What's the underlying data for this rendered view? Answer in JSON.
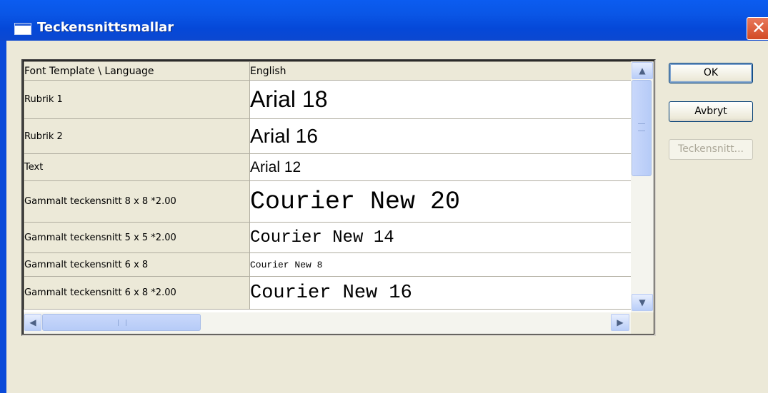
{
  "window": {
    "title": "Teckensnittsmallar",
    "close_glyph": "✕"
  },
  "grid": {
    "headers": [
      "Font Template \\ Language",
      "English"
    ],
    "rows": [
      {
        "template": "Rubrik 1",
        "font": "Arial 18"
      },
      {
        "template": "Rubrik 2",
        "font": "Arial 16"
      },
      {
        "template": "Text",
        "font": "Arial 12"
      },
      {
        "template": "Gammalt teckensnitt 8 x 8 *2.00",
        "font": "Courier New 20"
      },
      {
        "template": "Gammalt teckensnitt 5 x 5 *2.00",
        "font": "Courier New 14"
      },
      {
        "template": "Gammalt teckensnitt 6 x 8",
        "font": "Courier New 8"
      },
      {
        "template": "Gammalt teckensnitt 6 x 8 *2.00",
        "font": "Courier New 16"
      }
    ]
  },
  "scrollbar": {
    "up": "▲",
    "down": "▼",
    "left": "◀",
    "right": "▶"
  },
  "buttons": {
    "ok": "OK",
    "cancel": "Avbryt",
    "font": "Teckensnitt..."
  }
}
